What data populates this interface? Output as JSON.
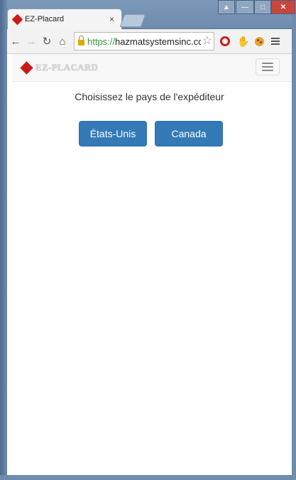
{
  "browser": {
    "tab_title": "EZ-Placard",
    "tab_close": "×",
    "url_scheme": "https://",
    "url_host": "hazmatsystemsinc.cc"
  },
  "navbar": {
    "brand": "EZ-PLACARD"
  },
  "main": {
    "prompt": "Choisissez le pays de l'expéditeur",
    "buttons": [
      {
        "label": "États-Unis"
      },
      {
        "label": "Canada"
      }
    ]
  },
  "colors": {
    "primary_button": "#337ab7",
    "logo_red": "#cc1a1a"
  }
}
